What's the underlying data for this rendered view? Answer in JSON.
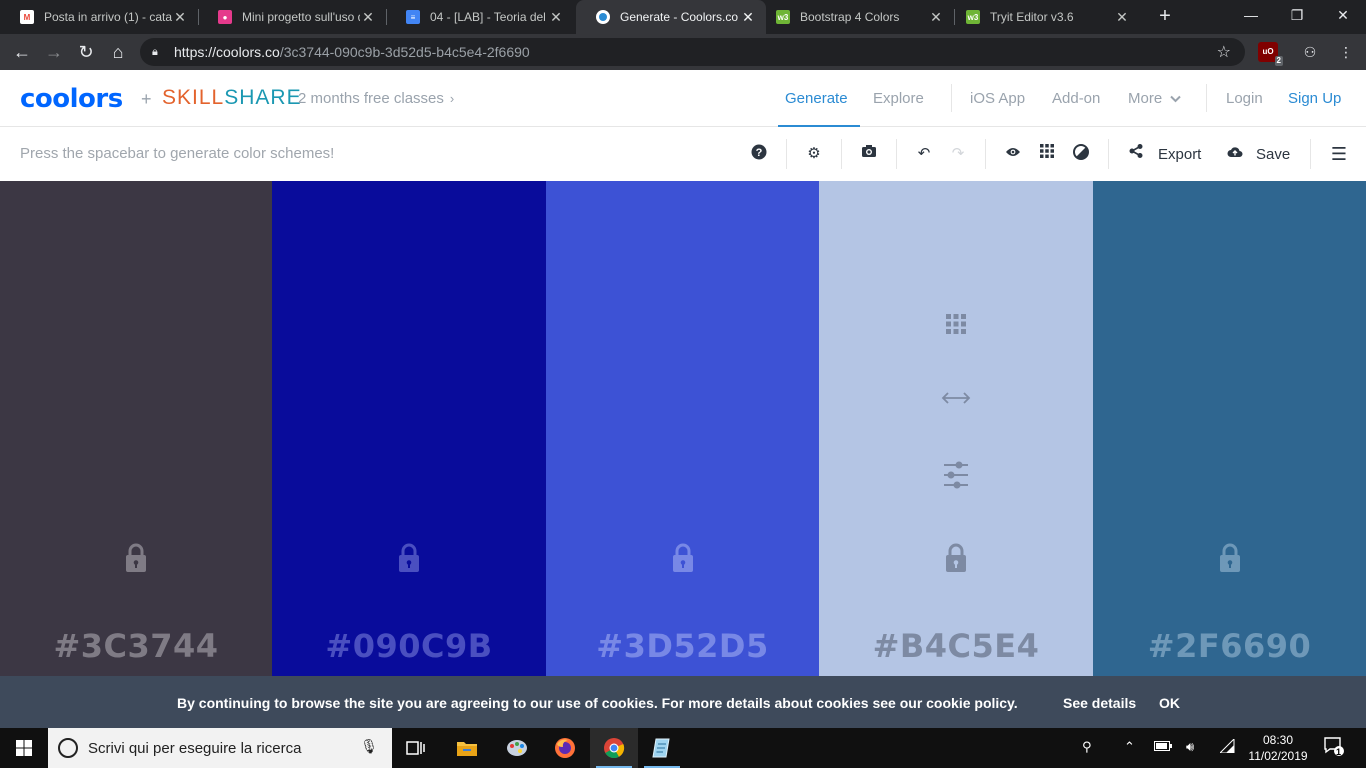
{
  "browser": {
    "tabs": [
      {
        "title": "Posta in arrivo (1) - cata",
        "icon": "gmail-icon",
        "color": "#ea4335"
      },
      {
        "title": "Mini progetto sull'uso d",
        "icon": "classroom-icon",
        "color": "#e53a8c"
      },
      {
        "title": "04 - [LAB] - Teoria del c",
        "icon": "docs-icon",
        "color": "#4285f4"
      },
      {
        "title": "Generate - Coolors.co",
        "icon": "coolors-icon",
        "color": "#2b8bd3"
      },
      {
        "title": "Bootstrap 4 Colors",
        "icon": "w3schools-icon",
        "color": "#6fb536"
      },
      {
        "title": "Tryit Editor v3.6",
        "icon": "w3schools-icon",
        "color": "#6fb536"
      }
    ],
    "url_host": "https://coolors.co",
    "url_path": "/3c3744-090c9b-3d52d5-b4c5e4-2f6690",
    "ublock_badge": "2",
    "ublock_label": "uO"
  },
  "site": {
    "logo": "coolors",
    "plus": "+",
    "partner": {
      "skill": "SKILL",
      "share": "SHARE"
    },
    "promo": "2 months free classes",
    "promo_chevron": "›",
    "nav": {
      "generate": "Generate",
      "explore": "Explore",
      "ios": "iOS App",
      "addon": "Add-on",
      "more": "More",
      "login": "Login",
      "signup": "Sign Up"
    }
  },
  "toolbar": {
    "hint": "Press the spacebar to generate color schemes!",
    "export": "Export",
    "save": "Save"
  },
  "palette": [
    {
      "hex": "#3C3744",
      "bg": "#3c3744",
      "fg": "#7f7b85"
    },
    {
      "hex": "#090C9B",
      "bg": "#090c9b",
      "fg": "#4a4fc0"
    },
    {
      "hex": "#3D52D5",
      "bg": "#3d52d5",
      "fg": "#7888e6"
    },
    {
      "hex": "#B4C5E4",
      "bg": "#b4c5e4",
      "fg": "#7d8aa3"
    },
    {
      "hex": "#2F6690",
      "bg": "#2f6690",
      "fg": "#6e98b8"
    }
  ],
  "cookie": {
    "message": "By continuing to browse the site you are agreeing to our use of cookies. For more details about cookies see our cookie policy.",
    "details": "See details",
    "ok": "OK"
  },
  "taskbar": {
    "search_placeholder": "Scrivi qui per eseguire la ricerca",
    "time": "08:30",
    "date": "11/02/2019",
    "notifications": "1"
  }
}
